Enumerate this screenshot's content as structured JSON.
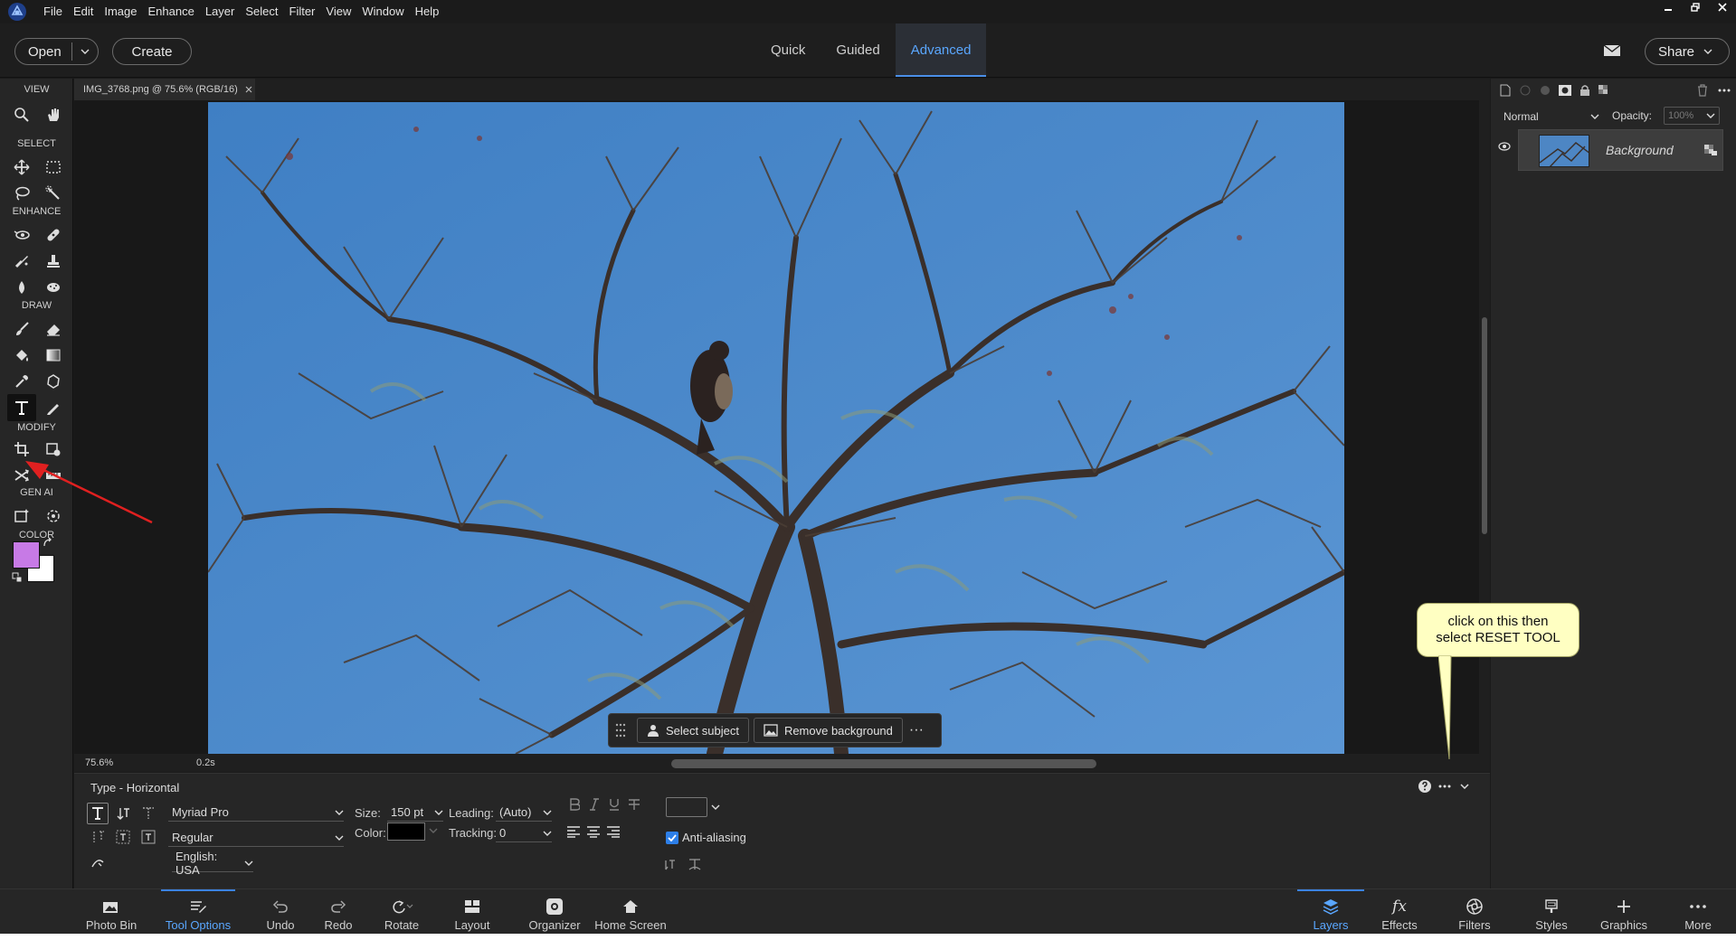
{
  "menubar": {
    "items": [
      "File",
      "Edit",
      "Image",
      "Enhance",
      "Layer",
      "Select",
      "Filter",
      "View",
      "Window",
      "Help"
    ]
  },
  "actionbar": {
    "open_label": "Open",
    "create_label": "Create",
    "modes": [
      "Quick",
      "Guided",
      "Advanced"
    ],
    "active_mode": "Advanced",
    "share_label": "Share"
  },
  "toolpanel": {
    "sections": [
      "VIEW",
      "SELECT",
      "ENHANCE",
      "DRAW",
      "MODIFY",
      "GEN AI",
      "COLOR"
    ],
    "foreground_color": "#c77ae6",
    "background_color": "#ffffff",
    "selected_tool": "type-tool"
  },
  "document": {
    "tab_title": "IMG_3768.png @ 75.6% (RGB/16)",
    "zoom": "75.6%",
    "timing": "0.2s"
  },
  "taskbar": {
    "select_subject": "Select subject",
    "remove_background": "Remove background",
    "more": "···"
  },
  "callout": {
    "line1": "click on this then",
    "line2": "select RESET TOOL"
  },
  "layers": {
    "blend_mode": "Normal",
    "opacity_label": "Opacity:",
    "opacity_value": "100%",
    "layer_name": "Background"
  },
  "options": {
    "title": "Type - Horizontal",
    "font_family": "Myriad Pro",
    "font_style": "Regular",
    "language": "English: USA",
    "size_label": "Size:",
    "size_value": "150 pt",
    "color_label": "Color:",
    "text_color": "#000000",
    "leading_label": "Leading:",
    "leading_value": "(Auto)",
    "tracking_label": "Tracking:",
    "tracking_value": "0",
    "anti_aliasing_label": "Anti-aliasing",
    "anti_aliasing": true
  },
  "bottombar": {
    "left": [
      "Photo Bin",
      "Tool Options",
      "Undo",
      "Redo",
      "Rotate",
      "Layout",
      "Organizer",
      "Home Screen"
    ],
    "right": [
      "Layers",
      "Effects",
      "Filters",
      "Styles",
      "Graphics",
      "More"
    ],
    "active_left": "Tool Options",
    "active_right": "Layers"
  },
  "colors": {
    "accent": "#4a8fe8",
    "sky": "#4a86c6",
    "callout_bg": "#ffffc2",
    "annotation_arrow": "#e02020"
  }
}
